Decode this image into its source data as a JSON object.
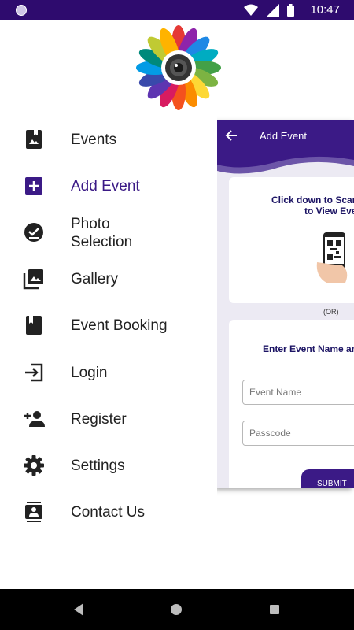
{
  "status_bar": {
    "time": "10:47"
  },
  "drawer": {
    "items": [
      {
        "label": "Events",
        "icon": "photo-album-icon",
        "active": false
      },
      {
        "label": "Add Event",
        "icon": "add-box-icon",
        "active": true
      },
      {
        "label": "Photo\nSelection",
        "icon": "check-circle-icon",
        "active": false
      },
      {
        "label": "Gallery",
        "icon": "photo-library-icon",
        "active": false
      },
      {
        "label": "Event Booking",
        "icon": "bookmark-book-icon",
        "active": false
      },
      {
        "label": "Login",
        "icon": "login-icon",
        "active": false
      },
      {
        "label": "Register",
        "icon": "person-add-icon",
        "active": false
      },
      {
        "label": "Settings",
        "icon": "gear-icon",
        "active": false
      },
      {
        "label": "Contact Us",
        "icon": "contacts-icon",
        "active": false
      }
    ]
  },
  "background_screen": {
    "title": "Add Event",
    "scan_line1": "Click down to Scan",
    "scan_line2": "to View Eve",
    "or_text": "(OR)",
    "enter_text": "Enter Event Name and",
    "event_name_placeholder": "Event Name",
    "passcode_placeholder": "Passcode",
    "submit_label": "SUBMIT"
  },
  "colors": {
    "primary": "#3b1a86",
    "status_bar": "#2e0b6e",
    "text": "#222222"
  }
}
